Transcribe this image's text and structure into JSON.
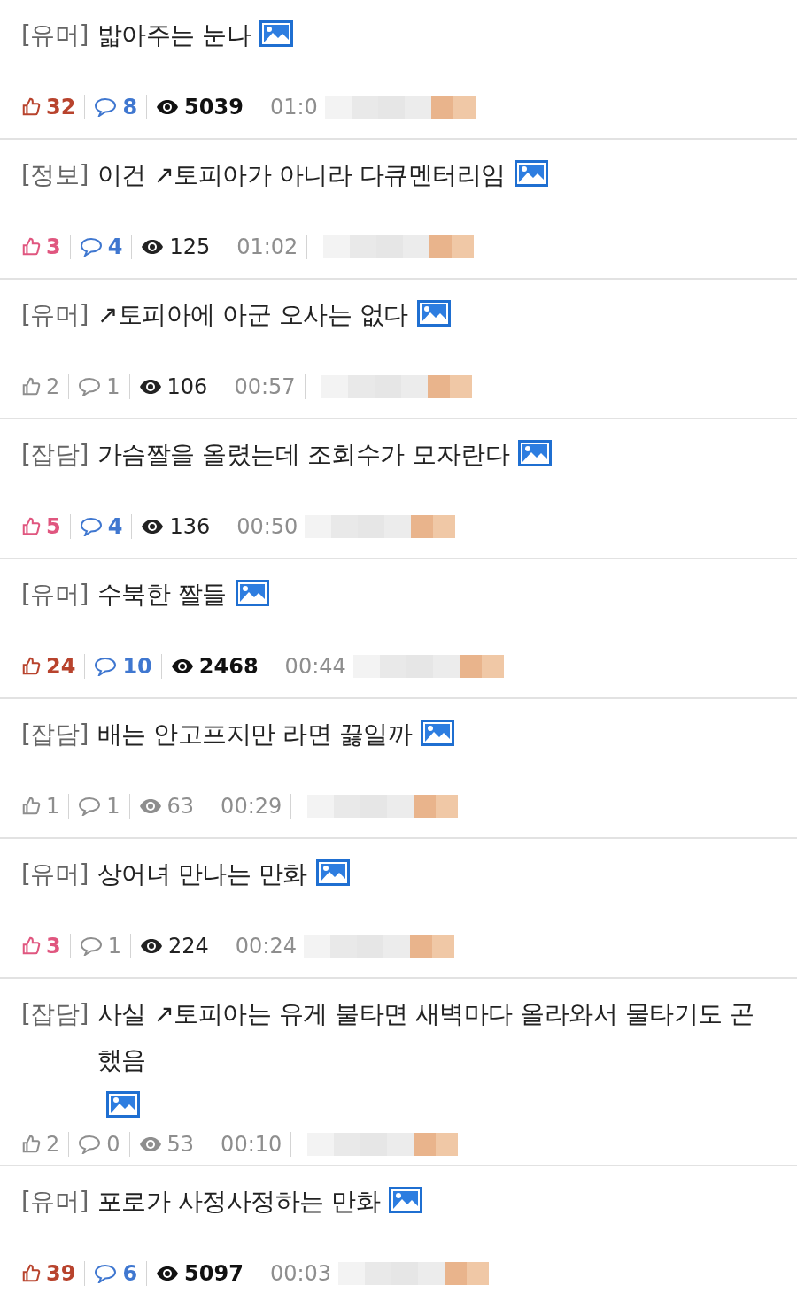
{
  "posts": [
    {
      "category": "[유머]",
      "title": "밟아주는 눈나",
      "likes": {
        "count": "32",
        "color": "#b8432d",
        "bold": true
      },
      "comments": {
        "count": "8",
        "color": "#3f77d0",
        "bold": true
      },
      "views": {
        "count": "5039",
        "color": "#111111",
        "bold": true
      },
      "time": "01:0",
      "time_divider": false
    },
    {
      "category": "[정보]",
      "title": "이건 ↗토피아가 아니라 다큐멘터리임",
      "likes": {
        "count": "3",
        "color": "#e0567f",
        "bold": true
      },
      "comments": {
        "count": "4",
        "color": "#3f77d0",
        "bold": true
      },
      "views": {
        "count": "125",
        "color": "#222222",
        "bold": false
      },
      "time": "01:02",
      "time_divider": true
    },
    {
      "category": "[유머]",
      "title": "↗토피아에 아군 오사는 없다",
      "likes": {
        "count": "2",
        "color": "#8e8e8e",
        "bold": false
      },
      "comments": {
        "count": "1",
        "color": "#8e8e8e",
        "bold": false
      },
      "views": {
        "count": "106",
        "color": "#222222",
        "bold": false
      },
      "time": "00:57",
      "time_divider": true
    },
    {
      "category": "[잡담]",
      "title": "가슴짤을 올렸는데 조회수가 모자란다",
      "likes": {
        "count": "5",
        "color": "#e0567f",
        "bold": true
      },
      "comments": {
        "count": "4",
        "color": "#3f77d0",
        "bold": true
      },
      "views": {
        "count": "136",
        "color": "#222222",
        "bold": false
      },
      "time": "00:50",
      "time_divider": false
    },
    {
      "category": "[유머]",
      "title": "수북한 짤들",
      "likes": {
        "count": "24",
        "color": "#b8432d",
        "bold": true
      },
      "comments": {
        "count": "10",
        "color": "#3f77d0",
        "bold": true
      },
      "views": {
        "count": "2468",
        "color": "#111111",
        "bold": true
      },
      "time": "00:44",
      "time_divider": false
    },
    {
      "category": "[잡담]",
      "title": "배는 안고프지만 라면 끓일까",
      "likes": {
        "count": "1",
        "color": "#8e8e8e",
        "bold": false
      },
      "comments": {
        "count": "1",
        "color": "#8e8e8e",
        "bold": false
      },
      "views": {
        "count": "63",
        "color": "#8e8e8e",
        "bold": false
      },
      "time": "00:29",
      "time_divider": true
    },
    {
      "category": "[유머]",
      "title": "상어녀 만나는 만화",
      "likes": {
        "count": "3",
        "color": "#e0567f",
        "bold": true
      },
      "comments": {
        "count": "1",
        "color": "#8e8e8e",
        "bold": false
      },
      "views": {
        "count": "224",
        "color": "#222222",
        "bold": false
      },
      "time": "00:24",
      "time_divider": false
    },
    {
      "category": "[잡담]",
      "title": "사실 ↗토피아는 유게 불타면 새벽마다 올라와서 물타기도 곤했음",
      "likes": {
        "count": "2",
        "color": "#8e8e8e",
        "bold": false
      },
      "comments": {
        "count": "0",
        "color": "#8e8e8e",
        "bold": false
      },
      "views": {
        "count": "53",
        "color": "#8e8e8e",
        "bold": false
      },
      "time": "00:10",
      "time_divider": true
    },
    {
      "category": "[유머]",
      "title": "포로가 사정사정하는 만화",
      "likes": {
        "count": "39",
        "color": "#b8432d",
        "bold": true
      },
      "comments": {
        "count": "6",
        "color": "#3f77d0",
        "bold": true
      },
      "views": {
        "count": "5097",
        "color": "#111111",
        "bold": true
      },
      "time": "00:03",
      "time_divider": false
    }
  ]
}
